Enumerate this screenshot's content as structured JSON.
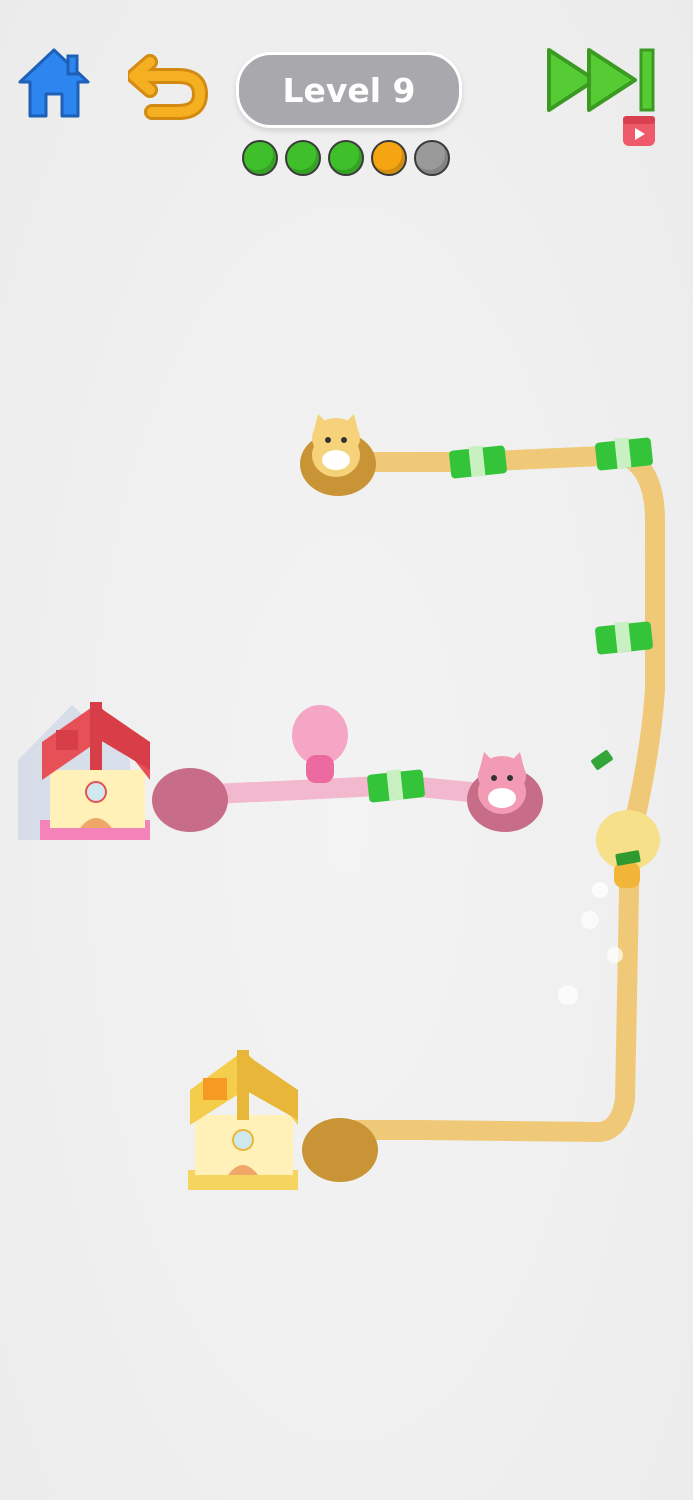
{
  "header": {
    "level_label": "Level 9"
  },
  "icons": {
    "home": "home-icon",
    "undo": "undo-icon",
    "skip": "fast-forward-icon",
    "video": "video-ad-icon"
  },
  "progress": {
    "total": 5,
    "current": 4,
    "dots": [
      {
        "state": "done",
        "color": "#3fbf2a"
      },
      {
        "state": "done",
        "color": "#3fbf2a"
      },
      {
        "state": "done",
        "color": "#3fbf2a"
      },
      {
        "state": "current",
        "color": "#f5a511"
      },
      {
        "state": "locked",
        "color": "#9a9a9a"
      }
    ]
  },
  "colors": {
    "home_icon": "#2d86f0",
    "undo_icon": "#f5b021",
    "skip_icon": "#55cc33",
    "yellow_path": "#efc978",
    "pink_path": "#f2b8cd",
    "red_house": "#e85058",
    "yellow_house": "#f5cd4c",
    "cash_green": "#33c43a"
  }
}
